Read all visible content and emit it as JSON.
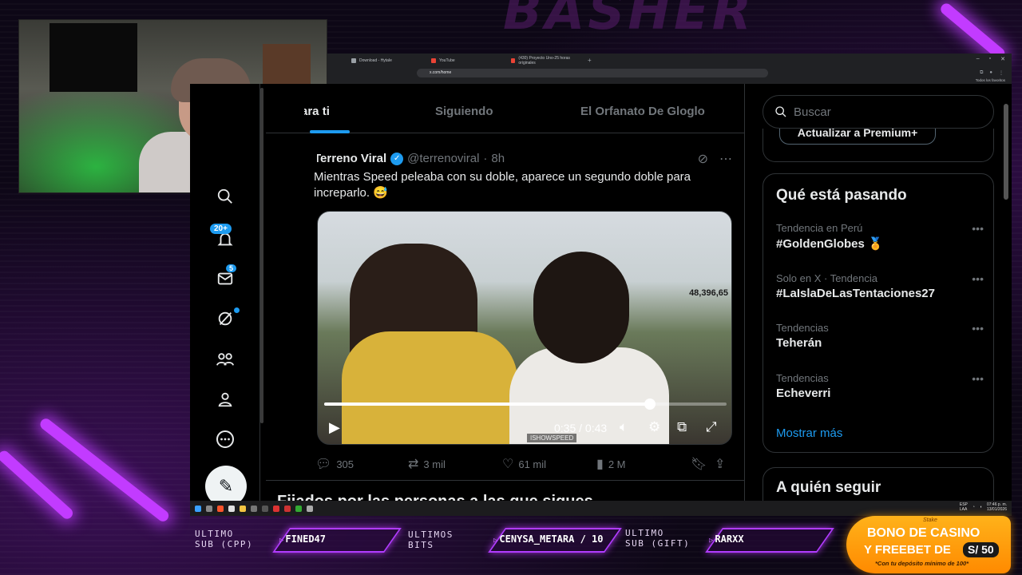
{
  "overlay": {
    "brand": "BASHER",
    "bar": {
      "last_sub_label": [
        "ULTIMO",
        "SUB (CPP)"
      ],
      "last_sub_value": "FINED47",
      "last_bits_label": [
        "ULTIMOS",
        "BITS"
      ],
      "last_bits_value": "CENYSA_METARA / 10",
      "last_gift_label": [
        "ULTIMO",
        "SUB (GIFT)"
      ],
      "last_gift_value": "RARXX"
    },
    "promo": {
      "brand": "Stake",
      "line1": "BONO DE CASINO",
      "line2": "Y FREEBET DE",
      "amount": "S/ 50",
      "line3": "*Con tu depósito mínimo de 100*"
    }
  },
  "browser": {
    "tabs": [
      {
        "label": "Download - Hytale",
        "icon": "hytale-favicon"
      },
      {
        "label": "YouTube",
        "icon": "youtube-favicon"
      },
      {
        "label": "(430) Proyecto Uno-25 horas originales",
        "icon": "youtube-favicon"
      }
    ],
    "url": "x.com/home",
    "bookmarks_label": "Todos los favoritos"
  },
  "nav": {
    "notifications_badge": "20+",
    "messages_badge": "5"
  },
  "feed": {
    "tabs": [
      "Para ti",
      "Siguiendo",
      "El Orfanato De Gloglo"
    ],
    "active_tab": 0,
    "tweet": {
      "name": "Terreno Viral",
      "handle": "@terrenoviral",
      "time": "8h",
      "text": "Mientras Speed peleaba con su doble, aparece un segundo doble para increparlo. 😅",
      "video": {
        "counter": "48,396,65",
        "watermark": "ISHOWSPEED",
        "time": "0:35 / 0:43",
        "progress": 0.81
      },
      "stats": {
        "replies": "305",
        "reposts": "3 mil",
        "likes": "61 mil",
        "views": "2 M"
      }
    },
    "next_section": "Fijados por las personas a las que sigues"
  },
  "sidebar": {
    "search_placeholder": "Buscar",
    "premium_button": "Actualizar a Premium+",
    "trends_title": "Qué está pasando",
    "trends": [
      {
        "context": "Tendencia en Perú",
        "name": "#GoldenGlobes 🏅"
      },
      {
        "context": "Solo en X · Tendencia",
        "name": "#LaIslaDeLasTentaciones27"
      },
      {
        "context": "Tendencias",
        "name": "Teherán"
      },
      {
        "context": "Tendencias",
        "name": "Echeverri"
      }
    ],
    "show_more": "Mostrar más",
    "follow_title": "A quién seguir"
  },
  "taskbar": {
    "lang": "ESP\nLAA",
    "clock_time": "07:46 p. m.",
    "clock_date": "13/01/2026"
  },
  "colors": {
    "accent_blue": "#1d9bf0",
    "neon_purple": "#b13cff",
    "promo_orange": "#ff9a0a"
  }
}
